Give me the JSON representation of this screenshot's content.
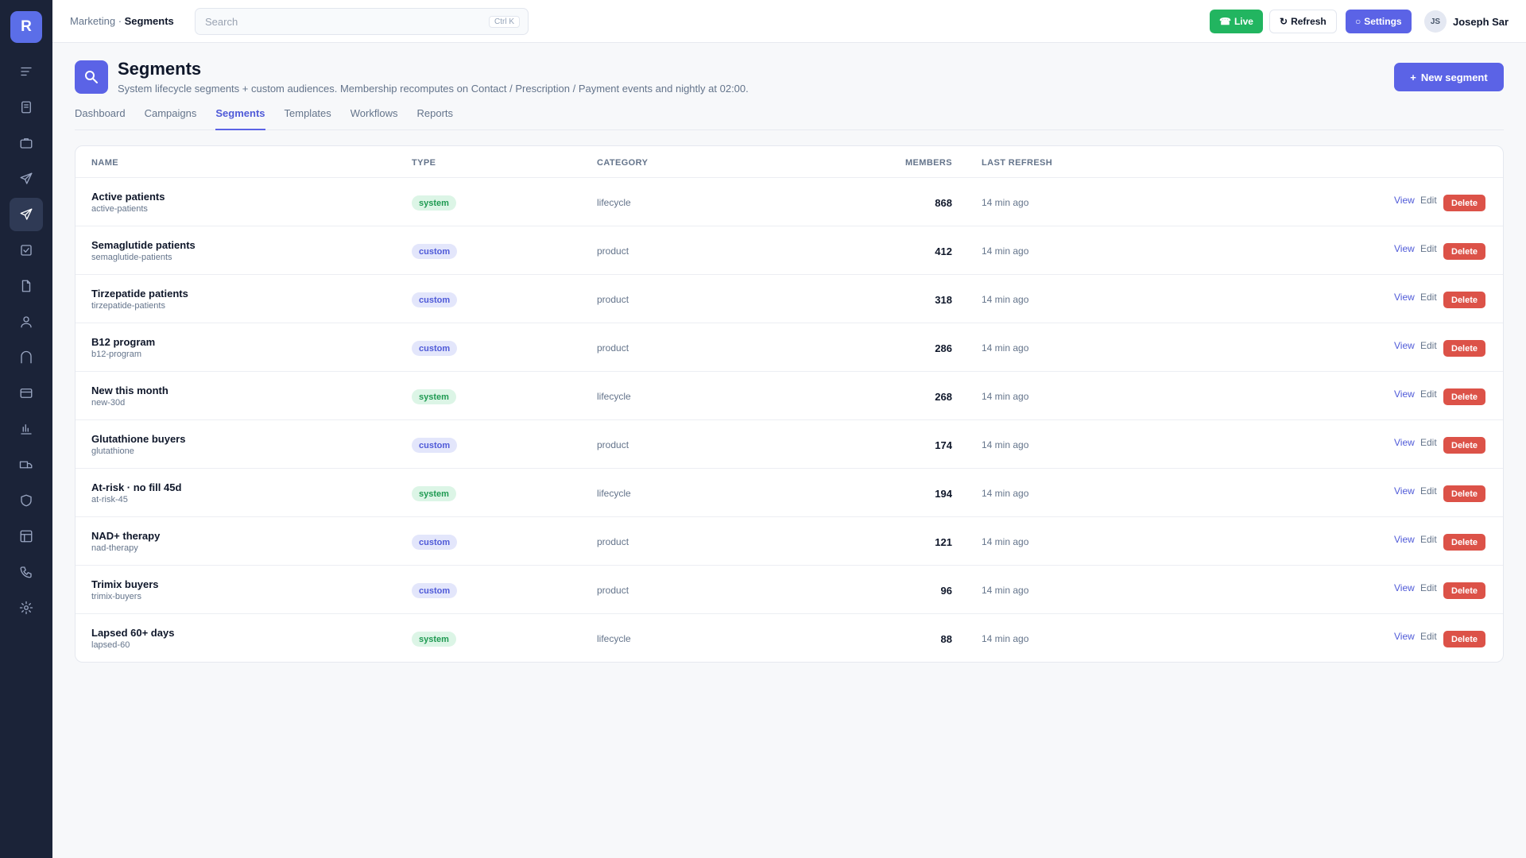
{
  "app": {
    "logo_letter": "R"
  },
  "sidebar": {
    "items": [
      {
        "icon": "menu-icon"
      },
      {
        "icon": "book-icon"
      },
      {
        "icon": "briefcase-icon"
      },
      {
        "icon": "send-icon"
      },
      {
        "icon": "send-icon",
        "active": true
      },
      {
        "icon": "check-square-icon"
      },
      {
        "icon": "file-icon"
      },
      {
        "icon": "user-icon"
      },
      {
        "icon": "arch-icon"
      },
      {
        "icon": "credit-card-icon"
      },
      {
        "icon": "bar-chart-icon"
      },
      {
        "icon": "truck-icon"
      },
      {
        "icon": "shield-icon"
      },
      {
        "icon": "grid-icon"
      },
      {
        "icon": "phone-icon"
      },
      {
        "icon": "gear-icon"
      }
    ]
  },
  "topbar": {
    "breadcrumb_parent": "Marketing",
    "breadcrumb_sep": " · ",
    "breadcrumb_current": "Segments",
    "search_placeholder": "Search",
    "search_shortcut": "Ctrl K",
    "live_label": "Live",
    "refresh_label": "Refresh",
    "settings_label": "Settings",
    "user_initials": "JS",
    "user_name": "Joseph Sar"
  },
  "header": {
    "title": "Segments",
    "subtitle": "System lifecycle segments + custom audiences. Membership recomputes on Contact / Prescription / Payment events and nightly at 02:00.",
    "new_button": "New segment"
  },
  "tabs": [
    {
      "label": "Dashboard"
    },
    {
      "label": "Campaigns"
    },
    {
      "label": "Segments",
      "active": true
    },
    {
      "label": "Templates"
    },
    {
      "label": "Workflows"
    },
    {
      "label": "Reports"
    }
  ],
  "table": {
    "columns": {
      "name": "NAME",
      "type": "TYPE",
      "category": "CATEGORY",
      "members": "MEMBERS",
      "last_refresh": "LAST REFRESH"
    },
    "actions": {
      "view": "View",
      "edit": "Edit",
      "delete": "Delete"
    },
    "rows": [
      {
        "name": "Active patients",
        "slug": "active-patients",
        "type": "system",
        "category": "lifecycle",
        "members": "868",
        "last_refresh": "14 min ago"
      },
      {
        "name": "Semaglutide patients",
        "slug": "semaglutide-patients",
        "type": "custom",
        "category": "product",
        "members": "412",
        "last_refresh": "14 min ago"
      },
      {
        "name": "Tirzepatide patients",
        "slug": "tirzepatide-patients",
        "type": "custom",
        "category": "product",
        "members": "318",
        "last_refresh": "14 min ago"
      },
      {
        "name": "B12 program",
        "slug": "b12-program",
        "type": "custom",
        "category": "product",
        "members": "286",
        "last_refresh": "14 min ago"
      },
      {
        "name": "New this month",
        "slug": "new-30d",
        "type": "system",
        "category": "lifecycle",
        "members": "268",
        "last_refresh": "14 min ago"
      },
      {
        "name": "Glutathione buyers",
        "slug": "glutathione",
        "type": "custom",
        "category": "product",
        "members": "174",
        "last_refresh": "14 min ago"
      },
      {
        "name": "At-risk · no fill 45d",
        "slug": "at-risk-45",
        "type": "system",
        "category": "lifecycle",
        "members": "194",
        "last_refresh": "14 min ago"
      },
      {
        "name": "NAD+ therapy",
        "slug": "nad-therapy",
        "type": "custom",
        "category": "product",
        "members": "121",
        "last_refresh": "14 min ago"
      },
      {
        "name": "Trimix buyers",
        "slug": "trimix-buyers",
        "type": "custom",
        "category": "product",
        "members": "96",
        "last_refresh": "14 min ago"
      },
      {
        "name": "Lapsed 60+ days",
        "slug": "lapsed-60",
        "type": "system",
        "category": "lifecycle",
        "members": "88",
        "last_refresh": "14 min ago"
      }
    ]
  },
  "colors": {
    "sidebar_bg": "#1b2338",
    "accent": "#5b63e6",
    "live_green": "#22b560",
    "delete_red": "#dc5248",
    "system_badge": "#1f9a52",
    "custom_badge": "#4f5ad8"
  }
}
